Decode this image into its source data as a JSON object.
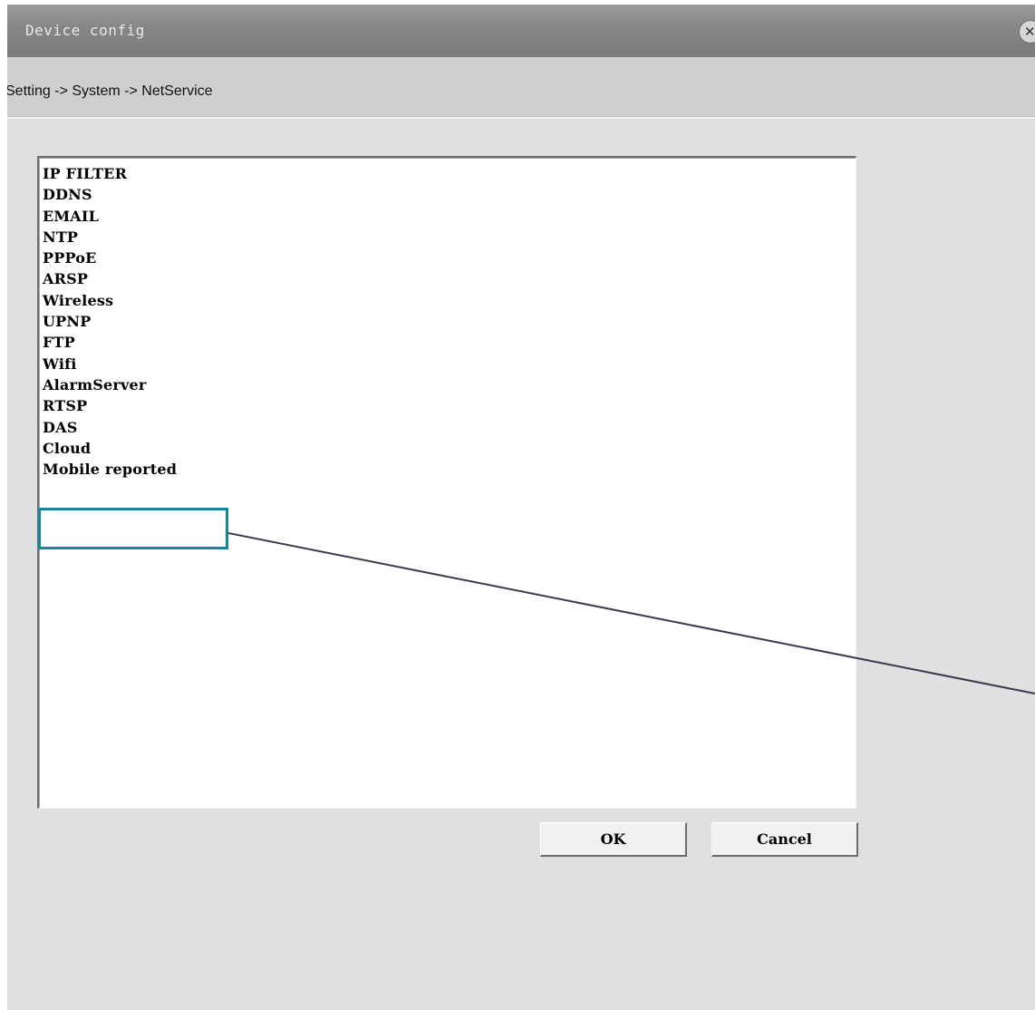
{
  "window": {
    "title": "Device config",
    "close_glyph": "✕"
  },
  "breadcrumb": "Setting -> System -> NetService",
  "services": [
    "IP FILTER",
    "DDNS",
    "EMAIL",
    "NTP",
    "PPPoE",
    "ARSP",
    "Wireless",
    "UPNP",
    "FTP",
    "Wifi",
    "AlarmServer",
    "RTSP",
    "DAS",
    "Cloud",
    "Mobile reported"
  ],
  "buttons": {
    "ok": "OK",
    "cancel": "Cancel"
  },
  "annotation": {
    "highlighted_item": "Mobile reported",
    "color": "#16859e",
    "line_color": "#3a3a4a"
  }
}
